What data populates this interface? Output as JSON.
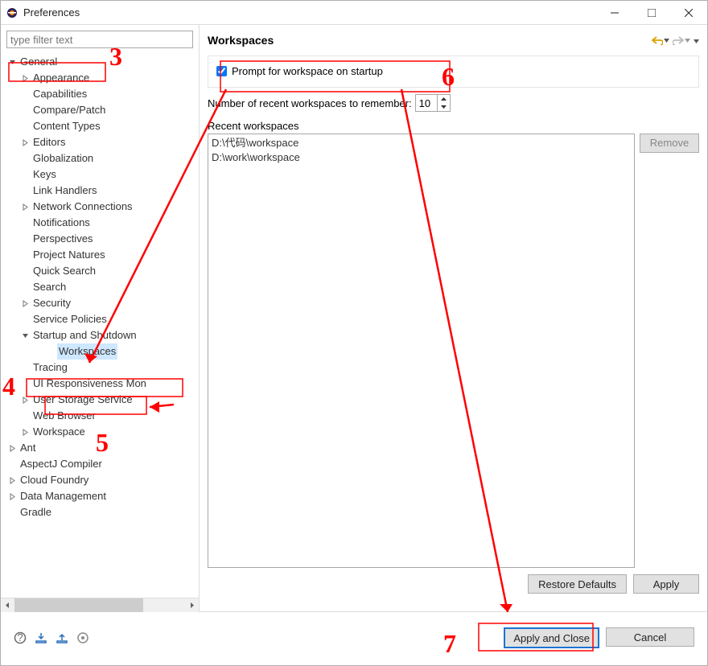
{
  "window": {
    "title": "Preferences"
  },
  "filter": {
    "placeholder": "type filter text"
  },
  "tree": {
    "items": [
      {
        "label": "General",
        "depth": 0,
        "arrow": "down"
      },
      {
        "label": "Appearance",
        "depth": 1,
        "arrow": "right"
      },
      {
        "label": "Capabilities",
        "depth": 1,
        "arrow": ""
      },
      {
        "label": "Compare/Patch",
        "depth": 1,
        "arrow": ""
      },
      {
        "label": "Content Types",
        "depth": 1,
        "arrow": ""
      },
      {
        "label": "Editors",
        "depth": 1,
        "arrow": "right"
      },
      {
        "label": "Globalization",
        "depth": 1,
        "arrow": ""
      },
      {
        "label": "Keys",
        "depth": 1,
        "arrow": ""
      },
      {
        "label": "Link Handlers",
        "depth": 1,
        "arrow": ""
      },
      {
        "label": "Network Connections",
        "depth": 1,
        "arrow": "right"
      },
      {
        "label": "Notifications",
        "depth": 1,
        "arrow": ""
      },
      {
        "label": "Perspectives",
        "depth": 1,
        "arrow": ""
      },
      {
        "label": "Project Natures",
        "depth": 1,
        "arrow": ""
      },
      {
        "label": "Quick Search",
        "depth": 1,
        "arrow": ""
      },
      {
        "label": "Search",
        "depth": 1,
        "arrow": ""
      },
      {
        "label": "Security",
        "depth": 1,
        "arrow": "right"
      },
      {
        "label": "Service Policies",
        "depth": 1,
        "arrow": ""
      },
      {
        "label": "Startup and Shutdown",
        "depth": 1,
        "arrow": "down"
      },
      {
        "label": "Workspaces",
        "depth": 2,
        "arrow": "",
        "selected": true
      },
      {
        "label": "Tracing",
        "depth": 1,
        "arrow": ""
      },
      {
        "label": "UI Responsiveness Mon",
        "depth": 1,
        "arrow": ""
      },
      {
        "label": "User Storage Service",
        "depth": 1,
        "arrow": "right"
      },
      {
        "label": "Web Browser",
        "depth": 1,
        "arrow": ""
      },
      {
        "label": "Workspace",
        "depth": 1,
        "arrow": "right"
      },
      {
        "label": "Ant",
        "depth": 0,
        "arrow": "right"
      },
      {
        "label": "AspectJ Compiler",
        "depth": 0,
        "arrow": ""
      },
      {
        "label": "Cloud Foundry",
        "depth": 0,
        "arrow": "right"
      },
      {
        "label": "Data Management",
        "depth": 0,
        "arrow": "right"
      },
      {
        "label": "Gradle",
        "depth": 0,
        "arrow": ""
      }
    ]
  },
  "panel": {
    "title": "Workspaces",
    "prompt_label": "Prompt for workspace on startup",
    "prompt_checked": true,
    "count_label": "Number of recent workspaces to remember:",
    "count_value": "10",
    "recent_label": "Recent workspaces",
    "recent_items": [
      "D:\\代码\\workspace",
      "D:\\work\\workspace"
    ],
    "remove": "Remove",
    "restore": "Restore Defaults",
    "apply": "Apply"
  },
  "footer": {
    "apply_close": "Apply and Close",
    "cancel": "Cancel"
  },
  "annotations": {
    "n3": "3",
    "n4": "4",
    "n5": "5",
    "n6": "6",
    "n7": "7"
  }
}
